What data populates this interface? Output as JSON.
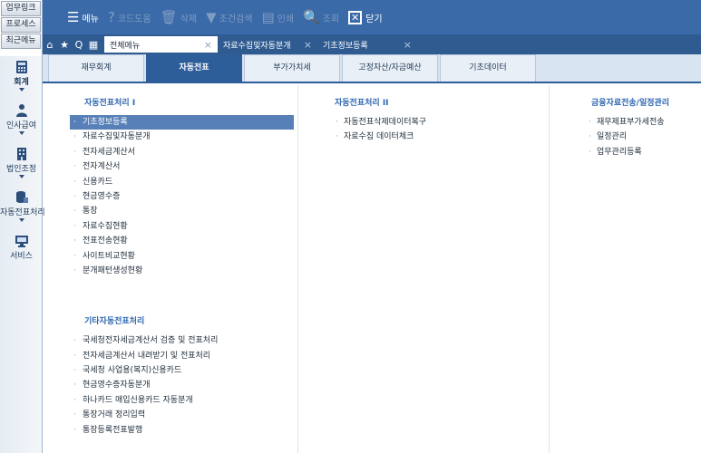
{
  "quick_links": [
    "업무링크",
    "프로세스",
    "최근메뉴"
  ],
  "nav": [
    {
      "label": "회계",
      "icon": "calculator-icon",
      "active": true
    },
    {
      "label": "인사급여",
      "icon": "person-icon",
      "active": false
    },
    {
      "label": "법인조정",
      "icon": "building-icon",
      "active": false
    },
    {
      "label": "자동전표처리",
      "icon": "database-icon",
      "active": false
    },
    {
      "label": "서비스",
      "icon": "monitor-icon",
      "active": false
    }
  ],
  "toolbar": {
    "menu": "메뉴",
    "code_help": "코드도움",
    "delete": "삭제",
    "condition_search": "조건검색",
    "print": "인쇄",
    "lookup": "조회",
    "close": "닫기"
  },
  "tabrow": {
    "tabs": [
      {
        "label": "전체메뉴",
        "active": true
      },
      {
        "label": "자료수집및자동분개",
        "active": false
      },
      {
        "label": "기초정보등록",
        "active": false
      }
    ]
  },
  "categories": [
    {
      "label": "재무회계",
      "active": false
    },
    {
      "label": "자동전표",
      "active": true
    },
    {
      "label": "부가가치세",
      "active": false
    },
    {
      "label": "고정자산/자금예산",
      "active": false
    },
    {
      "label": "기초데이터",
      "active": false
    }
  ],
  "columns": {
    "col1": {
      "title": "자동전표처리 I",
      "items": [
        "기초정보등록",
        "자료수집및자동분개",
        "전자세금계산서",
        "전자계산서",
        "신용카드",
        "현금영수증",
        "통장",
        "자료수집현황",
        "전표전송현황",
        "사이트비교현황",
        "분개패턴생성현황"
      ],
      "title2": "기타자동전표처리",
      "items2": [
        "국세청전자세금계산서 검증 및 전표처리",
        "전자세금계산서 내려받기 및 전표처리",
        "국세청 사업용(복지)신용카드",
        "현금영수증자동분개",
        "하나카드 매입신용카드 자동분개",
        "통장거래 정리입력",
        "통장등록전표발행"
      ]
    },
    "col2": {
      "title": "자동전표처리 II",
      "items": [
        "자동전표삭제데이터복구",
        "자료수집 데이터체크"
      ]
    },
    "col3": {
      "title": "금융자료전송/일정관리",
      "items": [
        "재무제표부가세전송",
        "일정관리",
        "업무관리등록"
      ]
    }
  }
}
